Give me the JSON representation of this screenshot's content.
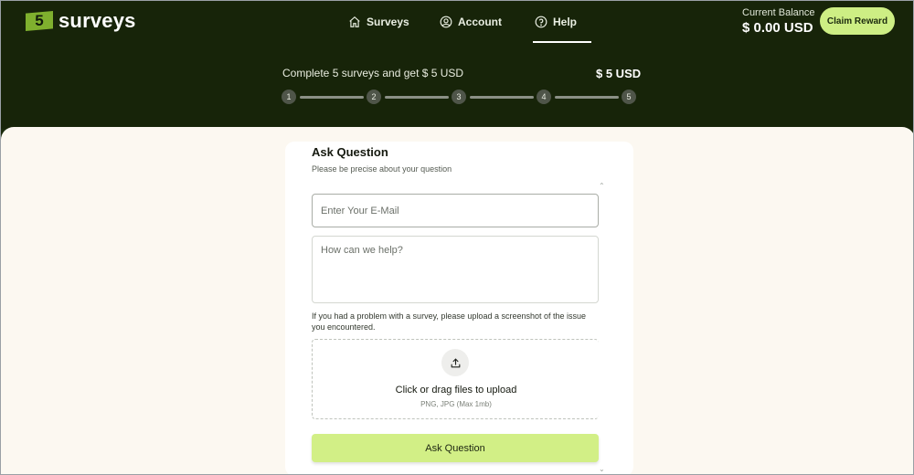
{
  "brand": {
    "badge": "5",
    "name": "surveys"
  },
  "nav": [
    {
      "label": "Surveys",
      "icon": "home-icon"
    },
    {
      "label": "Account",
      "icon": "user-circle-icon"
    },
    {
      "label": "Help",
      "icon": "help-circle-icon",
      "active": true
    }
  ],
  "balance": {
    "label": "Current Balance",
    "value": "$ 0.00 USD"
  },
  "claim_button": "Claim Reward",
  "progress": {
    "text": "Complete 5 surveys and get $ 5 USD",
    "reward": "$ 5 USD",
    "steps": [
      "1",
      "2",
      "3",
      "4",
      "5"
    ],
    "completed": 0
  },
  "form": {
    "title": "Ask Question",
    "subtitle": "Please be precise about your question",
    "email_placeholder": "Enter Your E-Mail",
    "message_placeholder": "How can we help?",
    "upload_note": "If you had a problem with a survey, please upload a screenshot of the issue you encountered.",
    "upload_title": "Click or drag files to upload",
    "upload_sub": "PNG, JPG (Max 1mb)",
    "submit": "Ask Question"
  },
  "colors": {
    "header_bg": "#172409",
    "accent": "#d2ef86",
    "content_bg": "#fcf8f1"
  }
}
